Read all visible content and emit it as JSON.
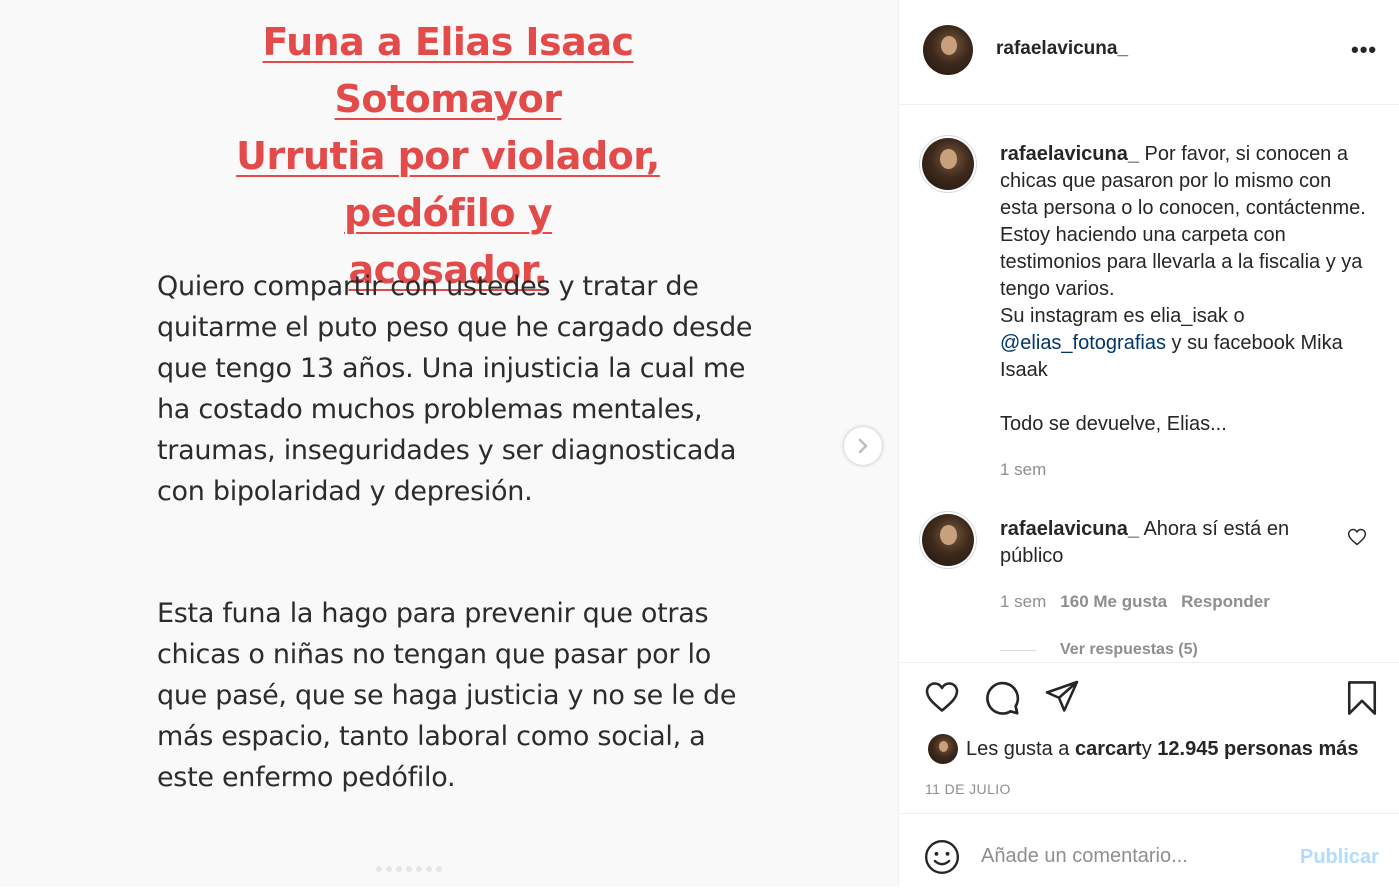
{
  "post": {
    "title_line1": "Funa a Elias Isaac Sotomayor",
    "title_line2": "Urrutia por violador, pedófilo y",
    "title_line3": "acosador.",
    "para1": "Quiero compartir con ustedes y tratar de quitarme el puto peso que he cargado desde que tengo 13 años. Una injusticia la cual me ha costado muchos problemas mentales, traumas, inseguridades y ser diagnosticada con bipolaridad y depresión.",
    "para2": "Esta funa la hago para prevenir que otras chicas o niñas no tengan que pasar por lo que pasé, que se haga justicia y no se le de más espacio, tanto laboral como social, a este enfermo pedófilo."
  },
  "header": {
    "username": "rafaelavicuna_",
    "more_label": "•••"
  },
  "caption": {
    "username": "rafaelavicuna_",
    "text_part1": " Por favor, si conocen a chicas que pasaron por lo mismo con esta persona o lo conocen, contáctenme. Estoy haciendo una carpeta con testimonios para llevarla a la fiscalia y ya tengo varios.",
    "text_part2": "Su instagram es elia_isak o ",
    "mention": "@elias_fotografias",
    "text_part3": " y su facebook Mika Isaak",
    "closing": "Todo se devuelve, Elias...",
    "time": "1 sem"
  },
  "comment": {
    "username": "rafaelavicuna_",
    "text": " Ahora sí está en público",
    "time": "1 sem",
    "likes": "160 Me gusta",
    "reply_label": "Responder",
    "view_replies": "Ver respuestas (5)"
  },
  "likes": {
    "prefix": "Les gusta a ",
    "user": "carcart",
    "middle": " y ",
    "count": "12.945 personas más"
  },
  "date": "11 DE JULIO",
  "comment_box": {
    "placeholder": "Añade un comentario...",
    "publish_label": "Publicar"
  },
  "carousel": {
    "total": 7,
    "active": 1
  },
  "colors": {
    "title_red": "#e34b4b",
    "link": "#00376b",
    "muted": "#8e8e8e",
    "publish_disabled": "#b3dbff"
  },
  "icons": [
    "next-arrow-icon",
    "more-options-icon",
    "heart-icon",
    "comment-icon",
    "share-icon",
    "bookmark-icon",
    "emoji-icon"
  ]
}
